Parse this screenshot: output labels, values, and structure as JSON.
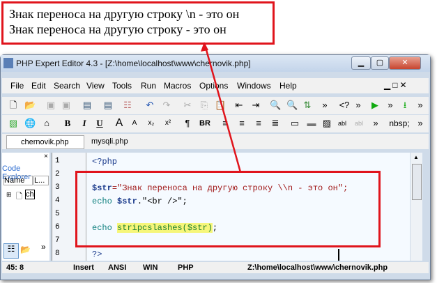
{
  "callout": {
    "line1": "Знак переноса на другую строку \\n - это он",
    "line2": "Знак переноса на другую строку - это он"
  },
  "window": {
    "title": "PHP Expert Editor 4.3 - [Z:\\home\\localhost\\www\\chernovik.php]"
  },
  "menu": [
    "File",
    "Edit",
    "Search",
    "View",
    "Tools",
    "Run",
    "Macros",
    "Options",
    "Windows",
    "Help"
  ],
  "toolbar2": {
    "bold": "B",
    "italic": "I",
    "underline": "U",
    "pilcrow": "¶",
    "br": "BR",
    "nbsp": "nbsp;"
  },
  "tabs": [
    "chernovik.php",
    "mysqli.php"
  ],
  "left_panel": {
    "title": "Code Explorer",
    "col_name": "Name",
    "col_l": "L...",
    "item": "ch"
  },
  "code": {
    "line_numbers": [
      "1",
      "2",
      "3",
      "4",
      "5",
      "6",
      "7",
      "8"
    ],
    "l1": "<?php",
    "l3_var": "$str",
    "l3_rest": "=\"Знак переноса на другую строку \\\\n - это он\";",
    "l4_kw": "echo ",
    "l4_var": "$str",
    "l4_rest": ".\"<br />\";",
    "l6_kw": "echo ",
    "l6_fn": "stripcslashes($str)",
    "l6_rest": ";",
    "l8": "?>"
  },
  "status": {
    "position": "45: 8",
    "mode": "Insert",
    "encoding": "ANSI",
    "lineend": "WIN",
    "syntax": "PHP",
    "path": "Z:\\home\\localhost\\www\\chernovik.php"
  },
  "colors": {
    "annotation": "#e0141c",
    "keyword": "#10807f",
    "highlight": "#f6f67a"
  }
}
